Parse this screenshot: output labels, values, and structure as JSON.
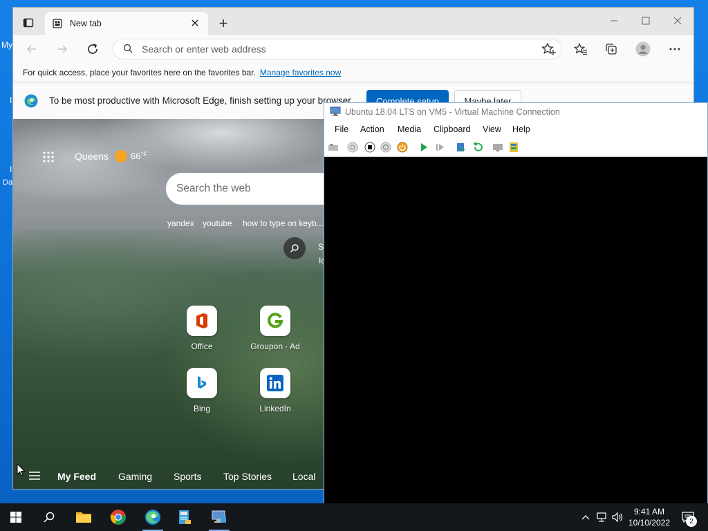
{
  "desktop": {
    "fragments": [
      "My",
      "I",
      "I",
      "Da"
    ]
  },
  "edge": {
    "tab_title": "New tab",
    "address_placeholder": "Search or enter web address",
    "favbar": {
      "message": "For quick access, place your favorites here on the favorites bar.",
      "link": "Manage favorites now"
    },
    "setup": {
      "message": "To be most productive with Microsoft Edge, finish setting up your browser",
      "primary": "Complete setup",
      "secondary": "Maybe later"
    },
    "ntp": {
      "location": "Queens",
      "temperature": "66",
      "temp_unit": "°F",
      "search_placeholder": "Search the web",
      "suggestions": [
        "yandex",
        "youtube",
        "how to type on keyb..."
      ],
      "side_fragments": [
        "S",
        "Ic"
      ],
      "tiles": [
        {
          "label": "Office",
          "icon": "office-icon"
        },
        {
          "label": "Groupon · Ad",
          "icon": "groupon-icon"
        },
        {
          "label": "Bing",
          "icon": "bing-icon"
        },
        {
          "label": "LinkedIn",
          "icon": "linkedin-icon"
        }
      ],
      "feed_items": [
        "My Feed",
        "Gaming",
        "Sports",
        "Top Stories",
        "Local"
      ]
    }
  },
  "vm": {
    "title": "Ubuntu 18.04 LTS on VM5 - Virtual Machine Connection",
    "menu": [
      "File",
      "Action",
      "Media",
      "Clipboard",
      "View",
      "Help"
    ]
  },
  "taskbar": {
    "time": "9:41 AM",
    "date": "10/10/2022",
    "notification_count": "2"
  }
}
